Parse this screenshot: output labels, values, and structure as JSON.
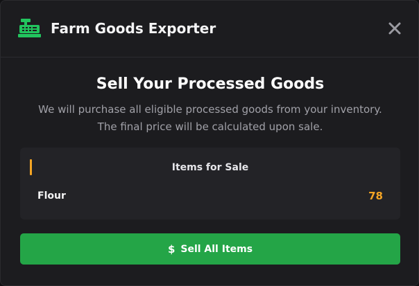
{
  "header": {
    "title": "Farm Goods Exporter",
    "icon": "cash-register-icon",
    "close_icon": "close-icon"
  },
  "main": {
    "title": "Sell Your Processed Goods",
    "description_line1": "We will purchase all eligible processed goods from your inventory.",
    "description_line2": "The final price will be calculated upon sale."
  },
  "items_panel": {
    "title": "Items for Sale",
    "items": [
      {
        "name": "Flour",
        "quantity": "78"
      }
    ]
  },
  "sell_button": {
    "icon_glyph": "$",
    "label": "Sell All Items"
  },
  "colors": {
    "accent_green": "#24a547",
    "accent_orange": "#f5a524",
    "background": "#1c1c1f"
  }
}
